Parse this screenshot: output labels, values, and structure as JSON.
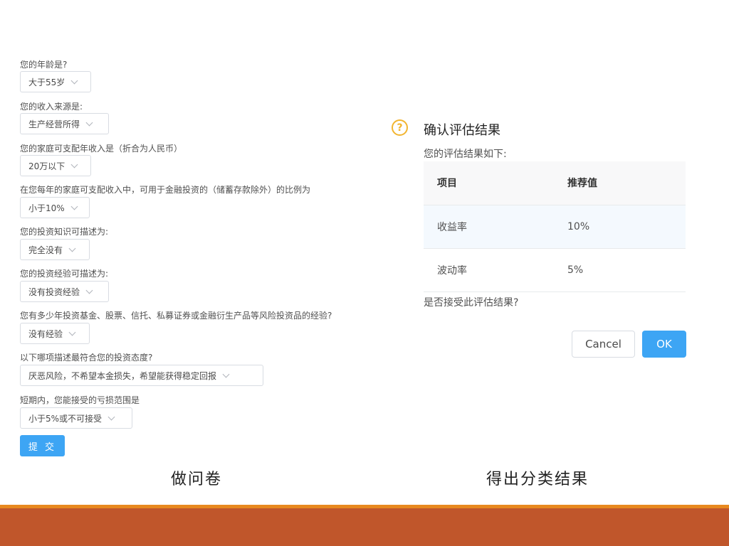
{
  "questionnaire": {
    "questions": [
      {
        "label": "您的年龄是?",
        "value": "大于55岁"
      },
      {
        "label": "您的收入来源是:",
        "value": "生产经营所得"
      },
      {
        "label": "您的家庭可支配年收入是（折合为人民币）",
        "value": "20万以下"
      },
      {
        "label": "在您每年的家庭可支配收入中，可用于金融投资的（储蓄存款除外）的比例为",
        "value": "小于10%"
      },
      {
        "label": "您的投资知识可描述为:",
        "value": "完全没有"
      },
      {
        "label": "您的投资经验可描述为:",
        "value": "没有投资经验"
      },
      {
        "label": "您有多少年投资基金、股票、信托、私募证券或金融衍生产品等风险投资品的经验?",
        "value": "没有经验"
      },
      {
        "label": "以下哪项描述最符合您的投资态度?",
        "value": "厌恶风险，不希望本金损失，希望能获得稳定回报"
      },
      {
        "label": "短期内，您能接受的亏损范围是",
        "value": "小于5%或不可接受"
      }
    ],
    "submit_label": "提 交"
  },
  "dialog": {
    "title": "确认评估结果",
    "description": "您的评估结果如下:",
    "table": {
      "headers": [
        "项目",
        "推荐值"
      ],
      "rows": [
        [
          "收益率",
          "10%"
        ],
        [
          "波动率",
          "5%"
        ]
      ]
    },
    "question": "是否接受此评估结果?",
    "cancel_label": "Cancel",
    "ok_label": "OK"
  },
  "captions": {
    "left": "做问卷",
    "right": "得出分类结果"
  },
  "colors": {
    "accent": "#3da5f4",
    "warning_icon": "#f2b530",
    "footer_stripe": "#e8891f",
    "footer_band": "#c0562b"
  },
  "icons": {
    "help": "question-circle-icon",
    "chevron": "chevron-down-icon"
  }
}
